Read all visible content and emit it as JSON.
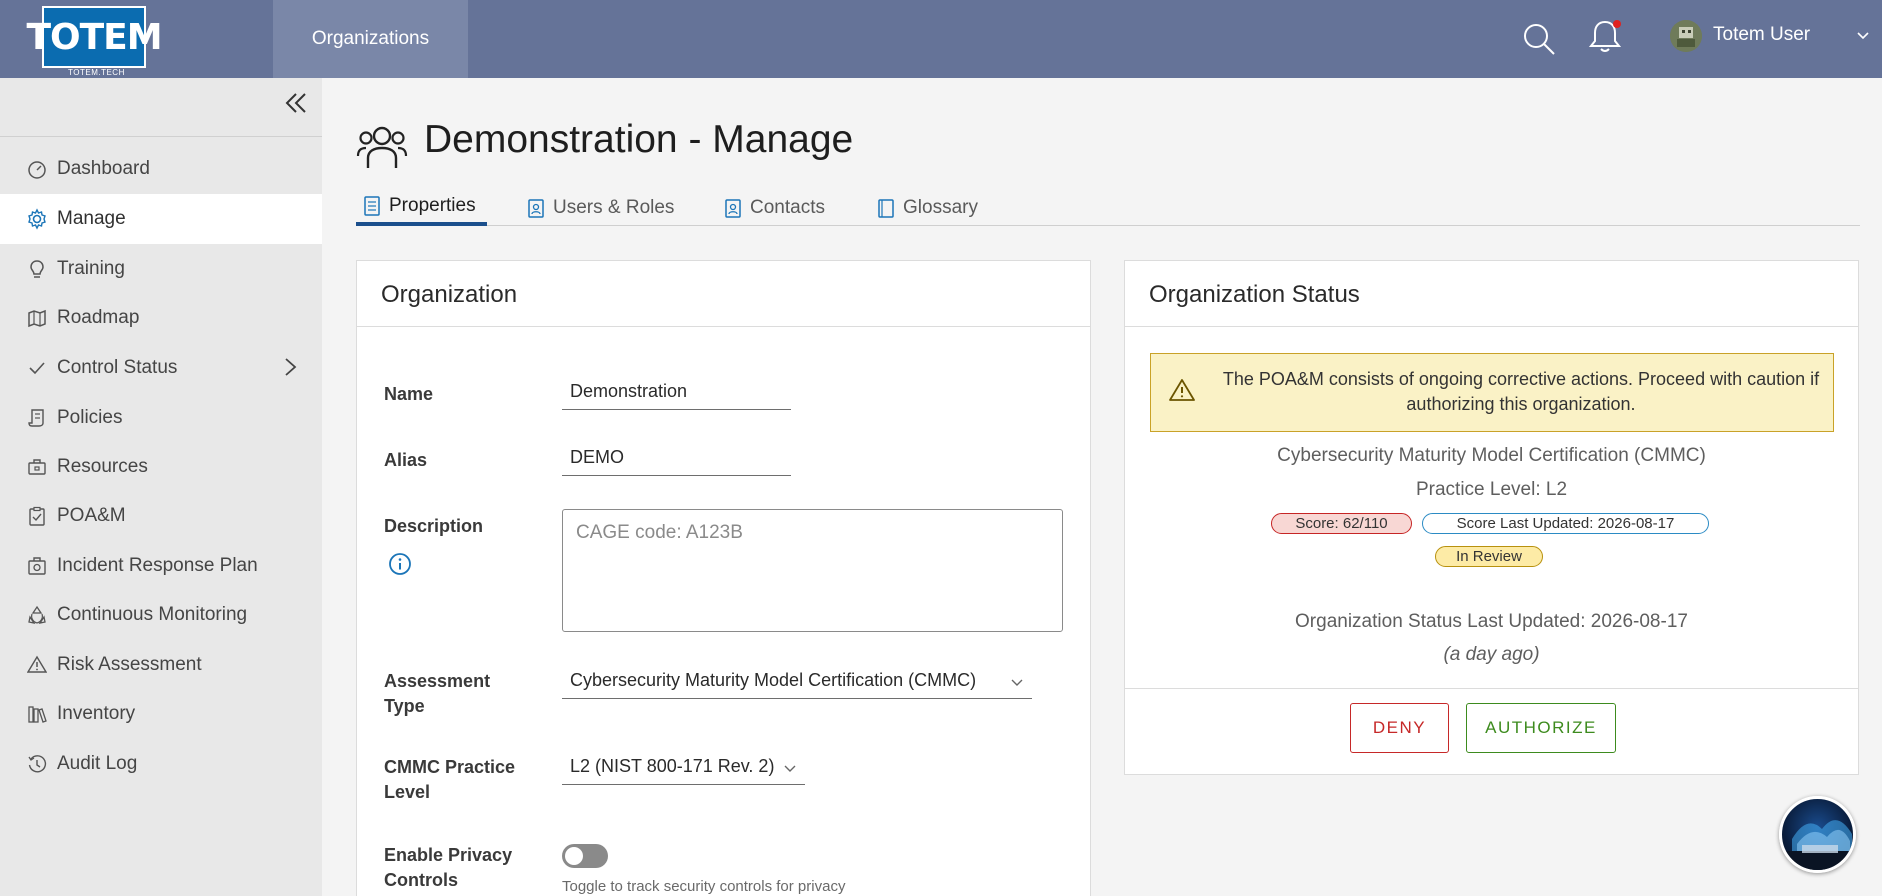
{
  "header": {
    "logo_text": "TOTEM",
    "logo_sub": "TOTEM.TECH",
    "nav_tab": "Organizations",
    "user_name": "Totem User"
  },
  "sidebar": {
    "items": [
      {
        "label": "Dashboard",
        "icon": "dashboard-icon"
      },
      {
        "label": "Manage",
        "icon": "gear-icon",
        "active": true
      },
      {
        "label": "Training",
        "icon": "lightbulb-icon"
      },
      {
        "label": "Roadmap",
        "icon": "map-icon"
      },
      {
        "label": "Control Status",
        "icon": "check-icon",
        "has_submenu": true
      },
      {
        "label": "Policies",
        "icon": "scroll-icon"
      },
      {
        "label": "Resources",
        "icon": "briefcase-icon"
      },
      {
        "label": "POA&M",
        "icon": "clipboard-icon"
      },
      {
        "label": "Incident Response Plan",
        "icon": "first-aid-icon"
      },
      {
        "label": "Continuous Monitoring",
        "icon": "recycle-icon"
      },
      {
        "label": "Risk Assessment",
        "icon": "warning-icon"
      },
      {
        "label": "Inventory",
        "icon": "books-icon"
      },
      {
        "label": "Audit Log",
        "icon": "history-icon"
      }
    ]
  },
  "page": {
    "title": "Demonstration - Manage",
    "tabs": [
      {
        "label": "Properties",
        "icon": "document-icon",
        "active": true
      },
      {
        "label": "Users & Roles",
        "icon": "badge-icon"
      },
      {
        "label": "Contacts",
        "icon": "contact-icon"
      },
      {
        "label": "Glossary",
        "icon": "book-icon"
      }
    ]
  },
  "organization": {
    "title": "Organization",
    "name_label": "Name",
    "name_value": "Demonstration",
    "alias_label": "Alias",
    "alias_value": "DEMO",
    "description_label": "Description",
    "description_placeholder": "CAGE code: A123B",
    "assessment_label": "Assessment Type",
    "assessment_value": "Cybersecurity Maturity Model Certification (CMMC)",
    "cmmc_label": "CMMC Practice Level",
    "cmmc_value": "L2 (NIST 800-171 Rev. 2)",
    "privacy_label": "Enable Privacy Controls",
    "privacy_enabled": false,
    "privacy_help": "Toggle to track security controls for privacy"
  },
  "status": {
    "title": "Organization Status",
    "alert": "The POA&M consists of ongoing corrective actions. Proceed with caution if authorizing this organization.",
    "framework": "Cybersecurity Maturity Model Certification (CMMC)",
    "practice_level": "Practice Level: L2",
    "score_badge": "Score: 62/110",
    "score_updated_badge": "Score Last Updated: 2026-08-17",
    "review_badge": "In Review",
    "status_updated": "Organization Status Last Updated: 2026-08-17",
    "status_ago": "(a day ago)",
    "deny_label": "DENY",
    "authorize_label": "AUTHORIZE"
  },
  "colors": {
    "header": "#657398",
    "active_tab_underline": "#1b4f8c",
    "deny": "#c62828",
    "authorize": "#3d8b1e"
  }
}
